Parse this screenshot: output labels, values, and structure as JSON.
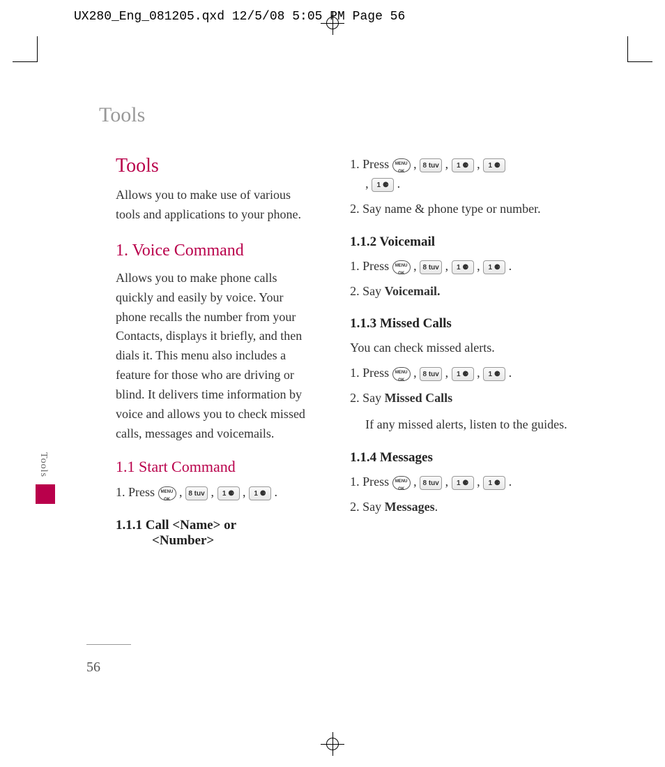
{
  "header": "UX280_Eng_081205.qxd  12/5/08  5:05 PM  Page 56",
  "running_head": "Tools",
  "side_tab": "Tools",
  "page_number": "56",
  "left": {
    "h1": "Tools",
    "intro": "Allows you to make use of various tools and applications to your phone.",
    "h2": "1. Voice Command",
    "p2": "Allows you to make phone calls quickly and easily by voice. Your phone recalls the number from your Contacts, displays it briefly, and then dials it. This menu also includes a feature for those who are driving or blind. It delivers time information by voice and allows you to check missed calls, messages and voicemails.",
    "h3": "1.1 Start Command",
    "step1_a": "1. Press ",
    "step1_b": " .",
    "h4": "1.1.1 Call <Name> or",
    "h4b": "<Number>"
  },
  "right": {
    "s111_a": "1. Press ",
    "s111_b": " .",
    "s111_2": "2. Say name & phone type or number.",
    "h112": "1.1.2 Voicemail",
    "s112_a": "1. Press ",
    "s112_b": " .",
    "s112_2a": "2. Say ",
    "s112_2b": "Voicemail.",
    "h113": "1.1.3 Missed Calls",
    "p113": "You can check missed alerts.",
    "s113_a": "1. Press ",
    "s113_b": " .",
    "s113_2a": "2. Say ",
    "s113_2b": "Missed Calls",
    "p113b": "If any missed alerts, listen to the guides.",
    "h114": "1.1.4 Messages",
    "s114_a": "1. Press ",
    "s114_b": " .",
    "s114_2a": "2. Say ",
    "s114_2b": "Messages",
    "s114_2c": "."
  },
  "keys": {
    "k8": "8 tuv",
    "k1": "1 ⚈"
  }
}
